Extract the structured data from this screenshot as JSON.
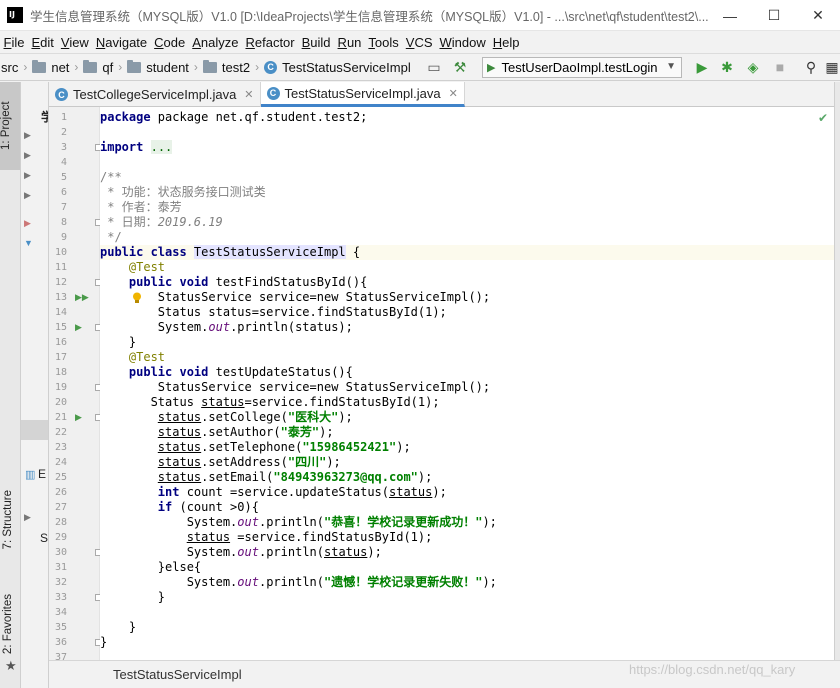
{
  "window": {
    "title": "学生信息管理系统（MYSQL版）V1.0 [D:\\IdeaProjects\\学生信息管理系统（MYSQL版）V1.0] - ...\\src\\net\\qf\\student\\test2\\...",
    "minimize": "—",
    "maximize": "☐",
    "close": "✕"
  },
  "menu": [
    "File",
    "Edit",
    "View",
    "Navigate",
    "Code",
    "Analyze",
    "Refactor",
    "Build",
    "Run",
    "Tools",
    "VCS",
    "Window",
    "Help"
  ],
  "breadcrumbs": [
    "src",
    "net",
    "qf",
    "student",
    "test2",
    "TestStatusServiceImpl"
  ],
  "run_config": "TestUserDaoImpl.testLogin",
  "left_tabs": [
    "1: Project",
    "7: Structure",
    "2: Favorites"
  ],
  "project_tree": [
    "学",
    "E",
    "S"
  ],
  "tabs": [
    {
      "label": "TestCollegeServiceImpl.java",
      "icon": "C"
    },
    {
      "label": "TestStatusServiceImpl.java",
      "icon": "C"
    }
  ],
  "code": {
    "l1": "package net.qf.student.test2;",
    "l3_kw": "import",
    "l3_fold": "...",
    "l8": "/**",
    "l9": " * 功能：状态服务接口测试类",
    "l10": " * 作者：泰芳",
    "l11_a": " * 日期：",
    "l11_b": "2019.6.19",
    "l12": " */",
    "l13_a": "public class ",
    "l13_b": "TestStatusServiceImpl",
    " l13_c": " {",
    "test": "@Test",
    "l15_a": "public void ",
    "l15_b": "testFindStatusById(){",
    "l16": "StatusService service=new StatusServiceImpl();",
    "l17": "Status status=service.findStatusById(1);",
    "l18_a": "System.",
    "l18_b": "out",
    "l18_c": ".println(status);",
    "close": "}",
    "l21_a": "public void ",
    "l21_b": "testUpdateStatus(){",
    "l22": "StatusService service=new StatusServiceImpl();",
    "l23_a": "Status ",
    "l23_b": "status",
    "l23_c": "=service.findStatusById(1);",
    "var": "status",
    "l24_a": ".setCollege(",
    "l24_s": "\"医科大\"",
    "l25_a": ".setAuthor(",
    "l25_s": "\"泰芳\"",
    "l26_a": ".setTelephone(",
    "l26_s": "\"15986452421\"",
    "l27_a": ".setAddress(",
    "l27_s": "\"四川\"",
    "l28_a": ".setEmail(",
    "l28_s": "\"84943963273@qq.com\"",
    "end": ");",
    "l29_a": "int ",
    "l29_b": "count =service.updateStatus(",
    "l29_c": ");",
    "l30_a": "if ",
    "l30_b": "(count >0){",
    "l31_s": "\"恭喜！学校记录更新成功！\"",
    "l32_b": " =service.findStatusById(1);",
    "l33_c": ".println(",
    "l34": "}else{",
    "l35_s": "\"遗憾！学校记录更新失败！\""
  },
  "status_text": "TestStatusServiceImpl",
  "watermark": "https://blog.csdn.net/qq_kary"
}
